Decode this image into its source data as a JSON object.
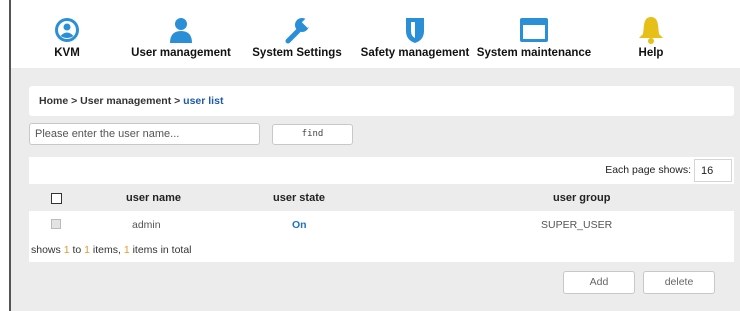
{
  "nav": {
    "items": [
      {
        "label": "KVM",
        "icon": "kvm-icon"
      },
      {
        "label": "User management",
        "icon": "user-icon"
      },
      {
        "label": "System Settings",
        "icon": "wrench-icon"
      },
      {
        "label": "Safety management",
        "icon": "shield-icon"
      },
      {
        "label": "System maintenance",
        "icon": "window-icon"
      },
      {
        "label": "Help",
        "icon": "bell-icon"
      }
    ]
  },
  "breadcrumb": {
    "home": "Home",
    "sep": " > ",
    "section": "User management",
    "current": "user list"
  },
  "search": {
    "placeholder": "Please enter the user name...",
    "find_label": "find"
  },
  "paging": {
    "label": "Each page shows:",
    "value": "16"
  },
  "table": {
    "headers": {
      "name": "user name",
      "state": "user state",
      "group": "user group"
    },
    "rows": [
      {
        "name": "admin",
        "state": "On",
        "group": "SUPER_USER"
      }
    ]
  },
  "summary": {
    "prefix": "shows ",
    "from": "1",
    "to_word": " to ",
    "to": "1",
    "items_word": " items, ",
    "total": "1",
    "suffix": " items in total"
  },
  "actions": {
    "add": "Add",
    "delete": "delete"
  },
  "colors": {
    "accent": "#1f72c4",
    "icon": "#2b8fd8",
    "bell": "#e6c019",
    "number": "#e69a2b",
    "background": "#ececec"
  }
}
